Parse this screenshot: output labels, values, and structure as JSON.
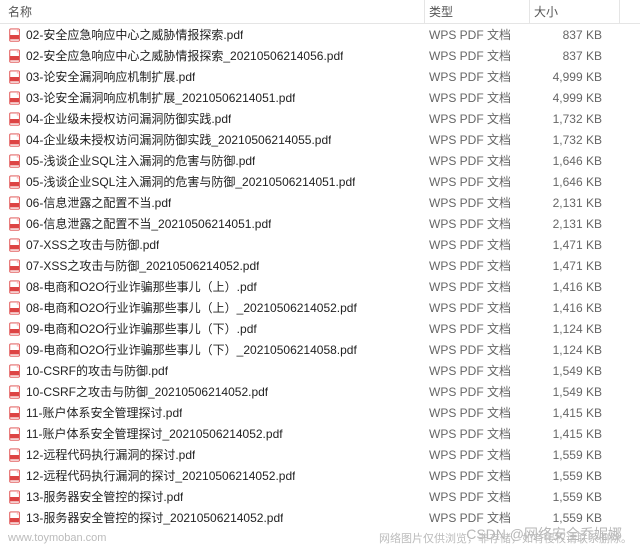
{
  "columns": {
    "name": "名称",
    "type": "类型",
    "size": "大小"
  },
  "file_type_label": "WPS PDF 文档",
  "files": [
    {
      "name": "02-安全应急响应中心之威胁情报探索.pdf",
      "size": "837 KB"
    },
    {
      "name": "02-安全应急响应中心之威胁情报探索_20210506214056.pdf",
      "size": "837 KB"
    },
    {
      "name": "03-论安全漏洞响应机制扩展.pdf",
      "size": "4,999 KB"
    },
    {
      "name": "03-论安全漏洞响应机制扩展_20210506214051.pdf",
      "size": "4,999 KB"
    },
    {
      "name": "04-企业级未授权访问漏洞防御实践.pdf",
      "size": "1,732 KB"
    },
    {
      "name": "04-企业级未授权访问漏洞防御实践_20210506214055.pdf",
      "size": "1,732 KB"
    },
    {
      "name": "05-浅谈企业SQL注入漏洞的危害与防御.pdf",
      "size": "1,646 KB"
    },
    {
      "name": "05-浅谈企业SQL注入漏洞的危害与防御_20210506214051.pdf",
      "size": "1,646 KB"
    },
    {
      "name": "06-信息泄露之配置不当.pdf",
      "size": "2,131 KB"
    },
    {
      "name": "06-信息泄露之配置不当_20210506214051.pdf",
      "size": "2,131 KB"
    },
    {
      "name": "07-XSS之攻击与防御.pdf",
      "size": "1,471 KB"
    },
    {
      "name": "07-XSS之攻击与防御_20210506214052.pdf",
      "size": "1,471 KB"
    },
    {
      "name": "08-电商和O2O行业诈骗那些事儿（上）.pdf",
      "size": "1,416 KB"
    },
    {
      "name": "08-电商和O2O行业诈骗那些事儿（上）_20210506214052.pdf",
      "size": "1,416 KB"
    },
    {
      "name": "09-电商和O2O行业诈骗那些事儿（下）.pdf",
      "size": "1,124 KB"
    },
    {
      "name": "09-电商和O2O行业诈骗那些事儿（下）_20210506214058.pdf",
      "size": "1,124 KB"
    },
    {
      "name": "10-CSRF的攻击与防御.pdf",
      "size": "1,549 KB"
    },
    {
      "name": "10-CSRF之攻击与防御_20210506214052.pdf",
      "size": "1,549 KB"
    },
    {
      "name": "11-账户体系安全管理探讨.pdf",
      "size": "1,415 KB"
    },
    {
      "name": "11-账户体系安全管理探讨_20210506214052.pdf",
      "size": "1,415 KB"
    },
    {
      "name": "12-远程代码执行漏洞的探讨.pdf",
      "size": "1,559 KB"
    },
    {
      "name": "12-远程代码执行漏洞的探讨_20210506214052.pdf",
      "size": "1,559 KB"
    },
    {
      "name": "13-服务器安全管控的探讨.pdf",
      "size": "1,559 KB"
    },
    {
      "name": "13-服务器安全管控的探讨_20210506214052.pdf",
      "size": "1,559 KB"
    }
  ],
  "footer": {
    "site": "www.toymoban.com",
    "note": "网络图片仅供浏览，非存储，如有侵权请联系删除。"
  },
  "watermark": "CSDN @网络安全乔妮娜"
}
